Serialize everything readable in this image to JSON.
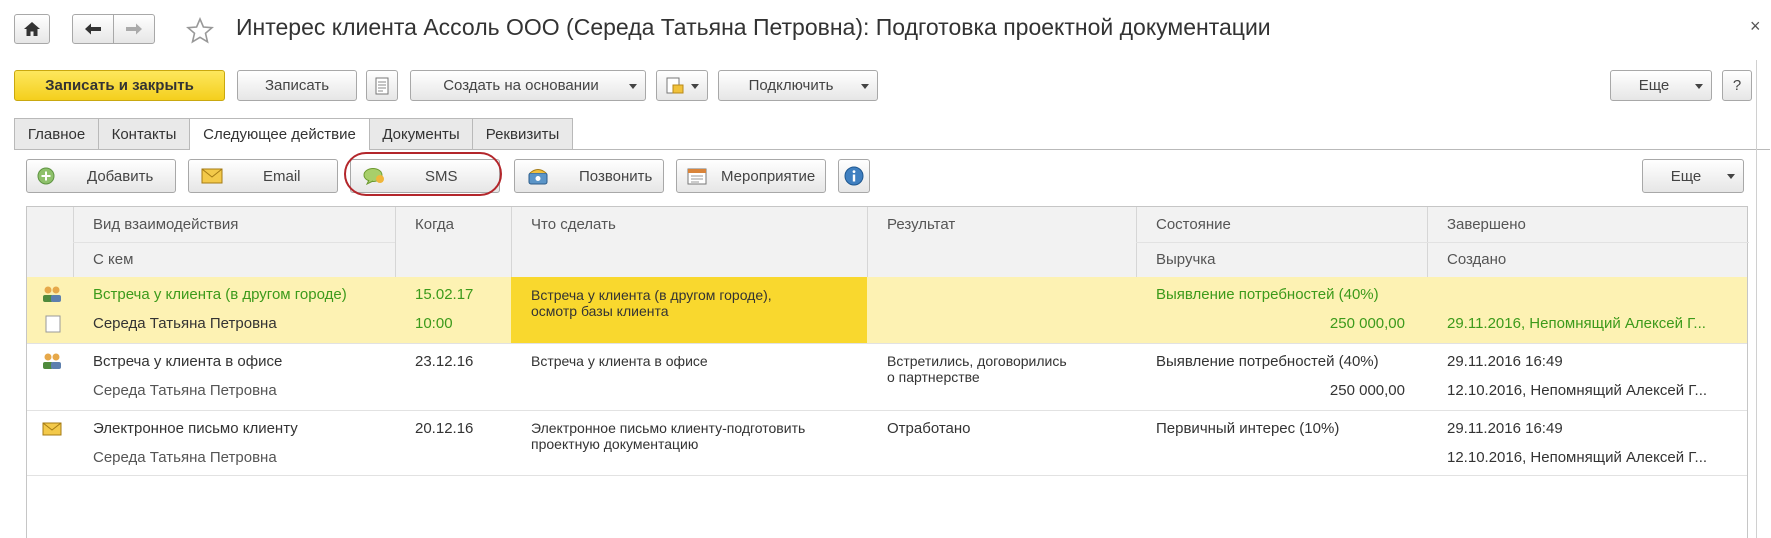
{
  "window": {
    "title": "Интерес клиента Ассоль ООО (Середа Татьяна Петровна): Подготовка проектной документации",
    "close": "×"
  },
  "nav": {
    "home_icon": "home-icon",
    "back_icon": "arrow-left-icon",
    "forward_icon": "arrow-right-icon",
    "favorite_icon": "star-icon"
  },
  "toolbar": {
    "save_close": "Записать и закрыть",
    "save": "Записать",
    "create_based": "Создать на основании",
    "connect": "Подключить",
    "more": "Еще",
    "help": "?"
  },
  "tabs": [
    {
      "label": "Главное"
    },
    {
      "label": "Контакты"
    },
    {
      "label": "Следующее действие"
    },
    {
      "label": "Документы"
    },
    {
      "label": "Реквизиты"
    }
  ],
  "actions": {
    "add": "Добавить",
    "email": "Email",
    "sms": "SMS",
    "call": "Позвонить",
    "event": "Мероприятие",
    "more": "Еще"
  },
  "table": {
    "headers": {
      "type": "Вид взаимодействия",
      "with": "С кем",
      "when": "Когда",
      "todo": "Что сделать",
      "result": "Результат",
      "state": "Состояние",
      "revenue": "Выручка",
      "done": "Завершено",
      "created": "Создано"
    },
    "rows": [
      {
        "type": "Встреча у клиента (в другом городе)",
        "with": "Середа Татьяна Петровна",
        "date": "15.02.17",
        "time": "10:00",
        "todo1": "Встреча у клиента (в другом городе),",
        "todo2": "осмотр базы клиента",
        "result1": "",
        "result2": "",
        "state": "Выявление потребностей (40%)",
        "revenue": "250 000,00",
        "done": "",
        "created": "29.11.2016, Непомнящий Алексей Г..."
      },
      {
        "type": "Встреча у клиента в офисе",
        "with": "Середа Татьяна Петровна",
        "date": "23.12.16",
        "time": "",
        "todo1": "Встреча у клиента в офисе",
        "todo2": "",
        "result1": "Встретились, договорились",
        "result2": "о партнерстве",
        "state": "Выявление потребностей (40%)",
        "revenue": "250 000,00",
        "done": "29.11.2016 16:49",
        "created": "12.10.2016, Непомнящий Алексей Г..."
      },
      {
        "type": "Электронное письмо клиенту",
        "with": "Середа Татьяна Петровна",
        "date": "20.12.16",
        "time": "",
        "todo1": "Электронное письмо клиенту-подготовить",
        "todo2": "проектную документацию",
        "result1": "Отработано",
        "result2": "",
        "state": "Первичный интерес (10%)",
        "revenue": "",
        "done": "29.11.2016 16:49",
        "created": "12.10.2016, Непомнящий Алексей Г..."
      }
    ]
  }
}
